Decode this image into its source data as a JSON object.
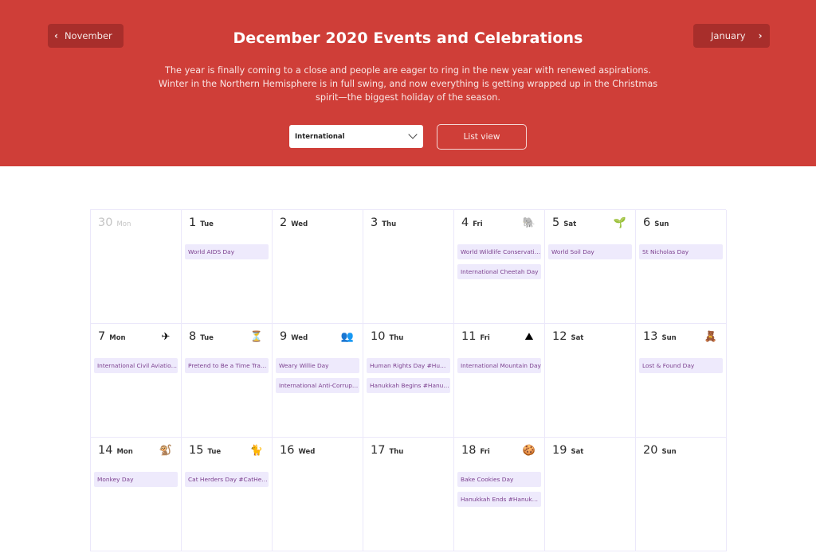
{
  "header": {
    "prev_month": "November",
    "next_month": "January",
    "title": "December 2020 Events and Celebrations",
    "description": "The year is finally coming to a close and people are eager to ring in the new year with renewed aspirations. Winter in the Northern Hemisphere is in full swing, and now everything is getting wrapped up in the Christmas spirit—the biggest holiday of the season.",
    "filter_value": "International",
    "list_view_label": "List view",
    "colors": {
      "brand": "#cf3e38",
      "event_bg": "#eeeafc",
      "event_text": "#7b3f8e"
    }
  },
  "calendar": {
    "days": [
      {
        "num": "30",
        "name": "Mon",
        "muted": true,
        "icon": null,
        "events": []
      },
      {
        "num": "1",
        "name": "Tue",
        "icon": null,
        "events": [
          "World AIDS Day"
        ]
      },
      {
        "num": "2",
        "name": "Wed",
        "icon": null,
        "events": []
      },
      {
        "num": "3",
        "name": "Thu",
        "icon": null,
        "events": []
      },
      {
        "num": "4",
        "name": "Fri",
        "icon": "elephant-icon",
        "glyph": "🐘",
        "events": [
          "World Wildlife Conservation Day",
          "International Cheetah Day"
        ]
      },
      {
        "num": "5",
        "name": "Sat",
        "icon": "soil-shovel-icon",
        "glyph": "🌱",
        "events": [
          "World Soil Day"
        ]
      },
      {
        "num": "6",
        "name": "Sun",
        "icon": null,
        "events": [
          "St Nicholas Day"
        ]
      },
      {
        "num": "7",
        "name": "Mon",
        "icon": "airplane-icon",
        "glyph": "✈",
        "events": [
          "International Civil Aviation Day"
        ]
      },
      {
        "num": "8",
        "name": "Tue",
        "icon": "time-traveler-icon",
        "glyph": "⏳",
        "events": [
          "Pretend to Be a Time Traveler Day"
        ]
      },
      {
        "num": "9",
        "name": "Wed",
        "icon": "people-group-icon",
        "glyph": "👥",
        "events": [
          "Weary Willie Day",
          "International Anti-Corruption Day"
        ]
      },
      {
        "num": "10",
        "name": "Thu",
        "icon": null,
        "events": [
          "Human Rights Day #HumanRightsDay",
          "Hanukkah Begins #Hanukkah"
        ]
      },
      {
        "num": "11",
        "name": "Fri",
        "icon": "mountain-icon",
        "glyph": "⛰",
        "events": [
          "International Mountain Day"
        ]
      },
      {
        "num": "12",
        "name": "Sat",
        "icon": null,
        "events": []
      },
      {
        "num": "13",
        "name": "Sun",
        "icon": "lost-found-icon",
        "glyph": "🧸",
        "events": [
          "Lost & Found Day"
        ]
      },
      {
        "num": "14",
        "name": "Mon",
        "icon": "monkey-icon",
        "glyph": "🐒",
        "events": [
          "Monkey Day"
        ]
      },
      {
        "num": "15",
        "name": "Tue",
        "icon": "cat-herder-icon",
        "glyph": "🐈",
        "events": [
          "Cat Herders Day #CatHerdersDay"
        ]
      },
      {
        "num": "16",
        "name": "Wed",
        "icon": null,
        "events": []
      },
      {
        "num": "17",
        "name": "Thu",
        "icon": null,
        "events": []
      },
      {
        "num": "18",
        "name": "Fri",
        "icon": "cookies-icon",
        "glyph": "🍪",
        "events": [
          "Bake Cookies Day",
          "Hanukkah Ends #Hanukkah"
        ]
      },
      {
        "num": "19",
        "name": "Sat",
        "icon": null,
        "events": []
      },
      {
        "num": "20",
        "name": "Sun",
        "icon": null,
        "events": []
      }
    ]
  }
}
